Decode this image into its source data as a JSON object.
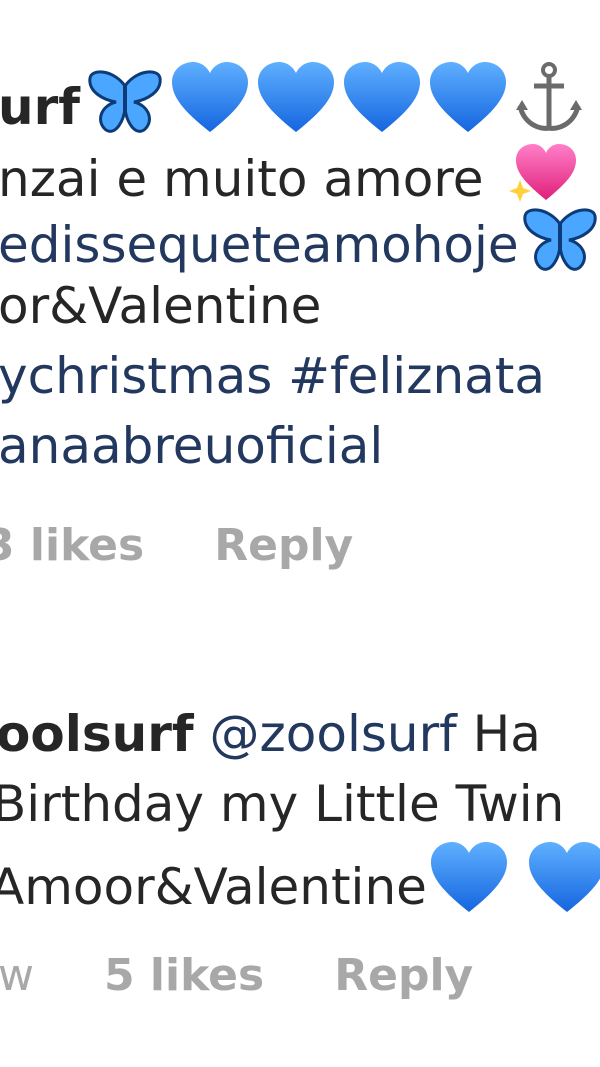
{
  "comment1": {
    "username": "urf",
    "lines": [
      "nzai e muito amore",
      "edissequeteamohoje",
      "or&Valentine",
      "ychristmas #feliznata",
      "anaabreuoficial"
    ],
    "likes": "3 likes",
    "reply": "Reply"
  },
  "comment2": {
    "username": "oolsurf",
    "mention": "@zoolsurf",
    "text_after_mention": "Ha",
    "lines": [
      "Birthday my Little Twin",
      "Amoor&Valentine"
    ],
    "time": "w",
    "likes": "5 likes",
    "reply": "Reply"
  },
  "icons": {
    "butterfly": "butterfly-emoji",
    "heart": "blue-heart-emoji",
    "anchor": "anchor-emoji",
    "sparkle_heart": "sparkling-heart-emoji"
  },
  "colors": {
    "text": "#262626",
    "link": "#22385f",
    "meta": "#a8a8a8",
    "heart": "#1f7bf0"
  }
}
